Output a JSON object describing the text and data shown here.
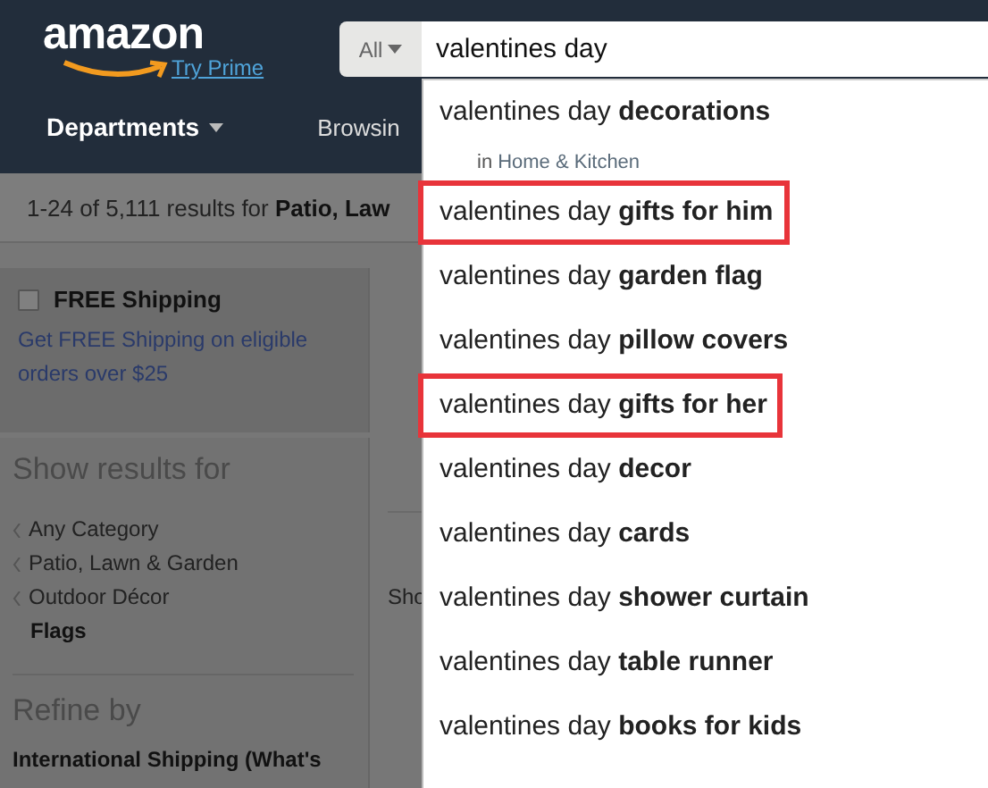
{
  "header": {
    "logo": "amazon",
    "prime_link": "Try Prime",
    "search": {
      "category": "All",
      "value": "valentines day"
    }
  },
  "nav": {
    "departments": "Departments",
    "browsing": "Browsin"
  },
  "results_bar": "1-24 of 5,111 results for **Patio, Law**",
  "sidebar": {
    "free_shipping": {
      "label": "FREE Shipping",
      "checked": false,
      "link": "Get FREE Shipping on eligible orders over $25"
    },
    "show_results_title": "Show results for",
    "categories": [
      {
        "label": "Any Category",
        "kind": "parent"
      },
      {
        "label": "Patio, Lawn & Garden",
        "kind": "parent"
      },
      {
        "label": "Outdoor Décor",
        "kind": "parent"
      },
      {
        "label": "Flags",
        "kind": "current"
      }
    ],
    "refine_title": "Refine by",
    "refine_item": "International Shipping (What's"
  },
  "content": {
    "sort_label": "Sho"
  },
  "suggestions": [
    {
      "text": "valentines day **decorations**",
      "highlighted": false,
      "department_prefix": "in",
      "department": "Home & Kitchen"
    },
    {
      "text": "valentines day **gifts for him**",
      "highlighted": true
    },
    {
      "text": "valentines day **garden flag**",
      "highlighted": false
    },
    {
      "text": "valentines day **pillow covers**",
      "highlighted": false
    },
    {
      "text": "valentines day **gifts for her**",
      "highlighted": true
    },
    {
      "text": "valentines day **decor**",
      "highlighted": false
    },
    {
      "text": "valentines day **cards**",
      "highlighted": false
    },
    {
      "text": "valentines day **shower curtain**",
      "highlighted": false
    },
    {
      "text": "valentines day **table runner**",
      "highlighted": false
    },
    {
      "text": "valentines day **books for kids**",
      "highlighted": false
    }
  ]
}
